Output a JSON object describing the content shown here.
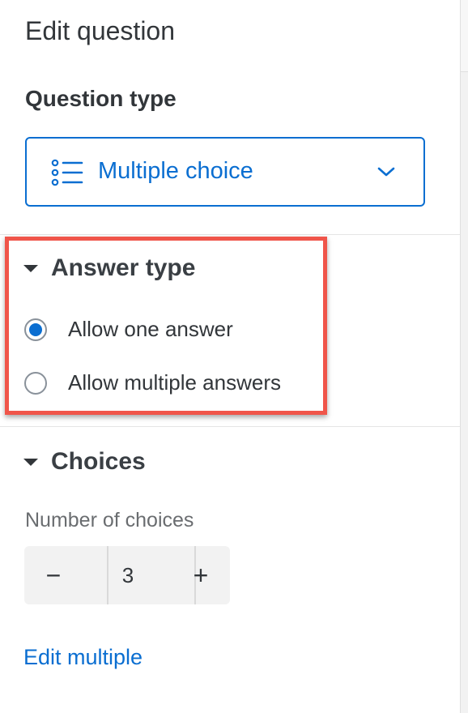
{
  "panel": {
    "title": "Edit question"
  },
  "question_type": {
    "label": "Question type",
    "selected": "Multiple choice",
    "icon": "list-icon",
    "chevron_icon": "chevron-down-icon"
  },
  "answer_type": {
    "title": "Answer type",
    "options": [
      {
        "label": "Allow one answer",
        "checked": true
      },
      {
        "label": "Allow multiple answers",
        "checked": false
      }
    ]
  },
  "choices": {
    "title": "Choices",
    "number_label": "Number of choices",
    "value": "3",
    "minus": "−",
    "plus": "+"
  },
  "links": {
    "edit_multiple": "Edit multiple"
  },
  "colors": {
    "accent": "#0a6ed1",
    "highlight": "#f0554a",
    "text": "#32363a"
  }
}
